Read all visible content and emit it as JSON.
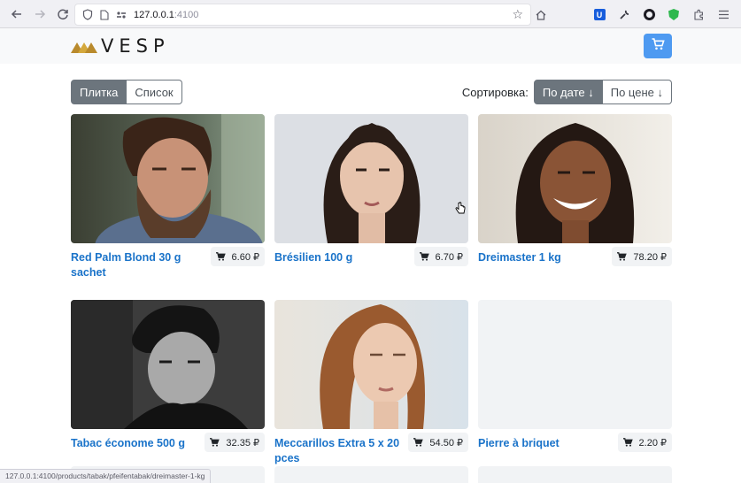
{
  "browser": {
    "url_host": "127.0.0.1",
    "url_port": ":4100",
    "status_link": "127.0.0.1:4100/products/tabak/pfeifentabak/dreimaster-1-kg",
    "icons": [
      "back-arrow-icon",
      "forward-arrow-icon",
      "reload-icon",
      "shield-icon",
      "page-icon",
      "connection-icon",
      "bookmark-star-icon",
      "home-icon",
      "bitwarden-icon",
      "wrench-icon",
      "extension-ring-icon",
      "privacy-shield-icon",
      "puzzle-icon",
      "menu-icon"
    ]
  },
  "header": {
    "logo_text": "VESP",
    "cart_icon": "cart-icon",
    "accent_color": "#4e9af1"
  },
  "toolbar": {
    "view_tile": "Плитка",
    "view_list": "Список",
    "sort_label": "Сортировка:",
    "sort_date": "По дате ↓",
    "sort_price": "По цене ↓"
  },
  "products": [
    {
      "name": "Red Palm Blond 30 g sachet",
      "price": "6.60 ₽",
      "image": "photo-bearded-man"
    },
    {
      "name": "Brésilien 100 g",
      "price": "6.70 ₽",
      "image": "photo-brunette-woman"
    },
    {
      "name": "Dreimaster 1 kg",
      "price": "78.20 ₽",
      "image": "photo-smiling-woman-braids"
    },
    {
      "name": "Tabac économe 500 g",
      "price": "32.35 ₽",
      "image": "photo-man-bw"
    },
    {
      "name": "Meccarillos Extra 5 x 20 pces",
      "price": "54.50 ₽",
      "image": "photo-redhead-woman"
    },
    {
      "name": "Pierre à briquet",
      "price": "2.20 ₽",
      "image": "no-image"
    }
  ],
  "link_color": "#1a73c9"
}
